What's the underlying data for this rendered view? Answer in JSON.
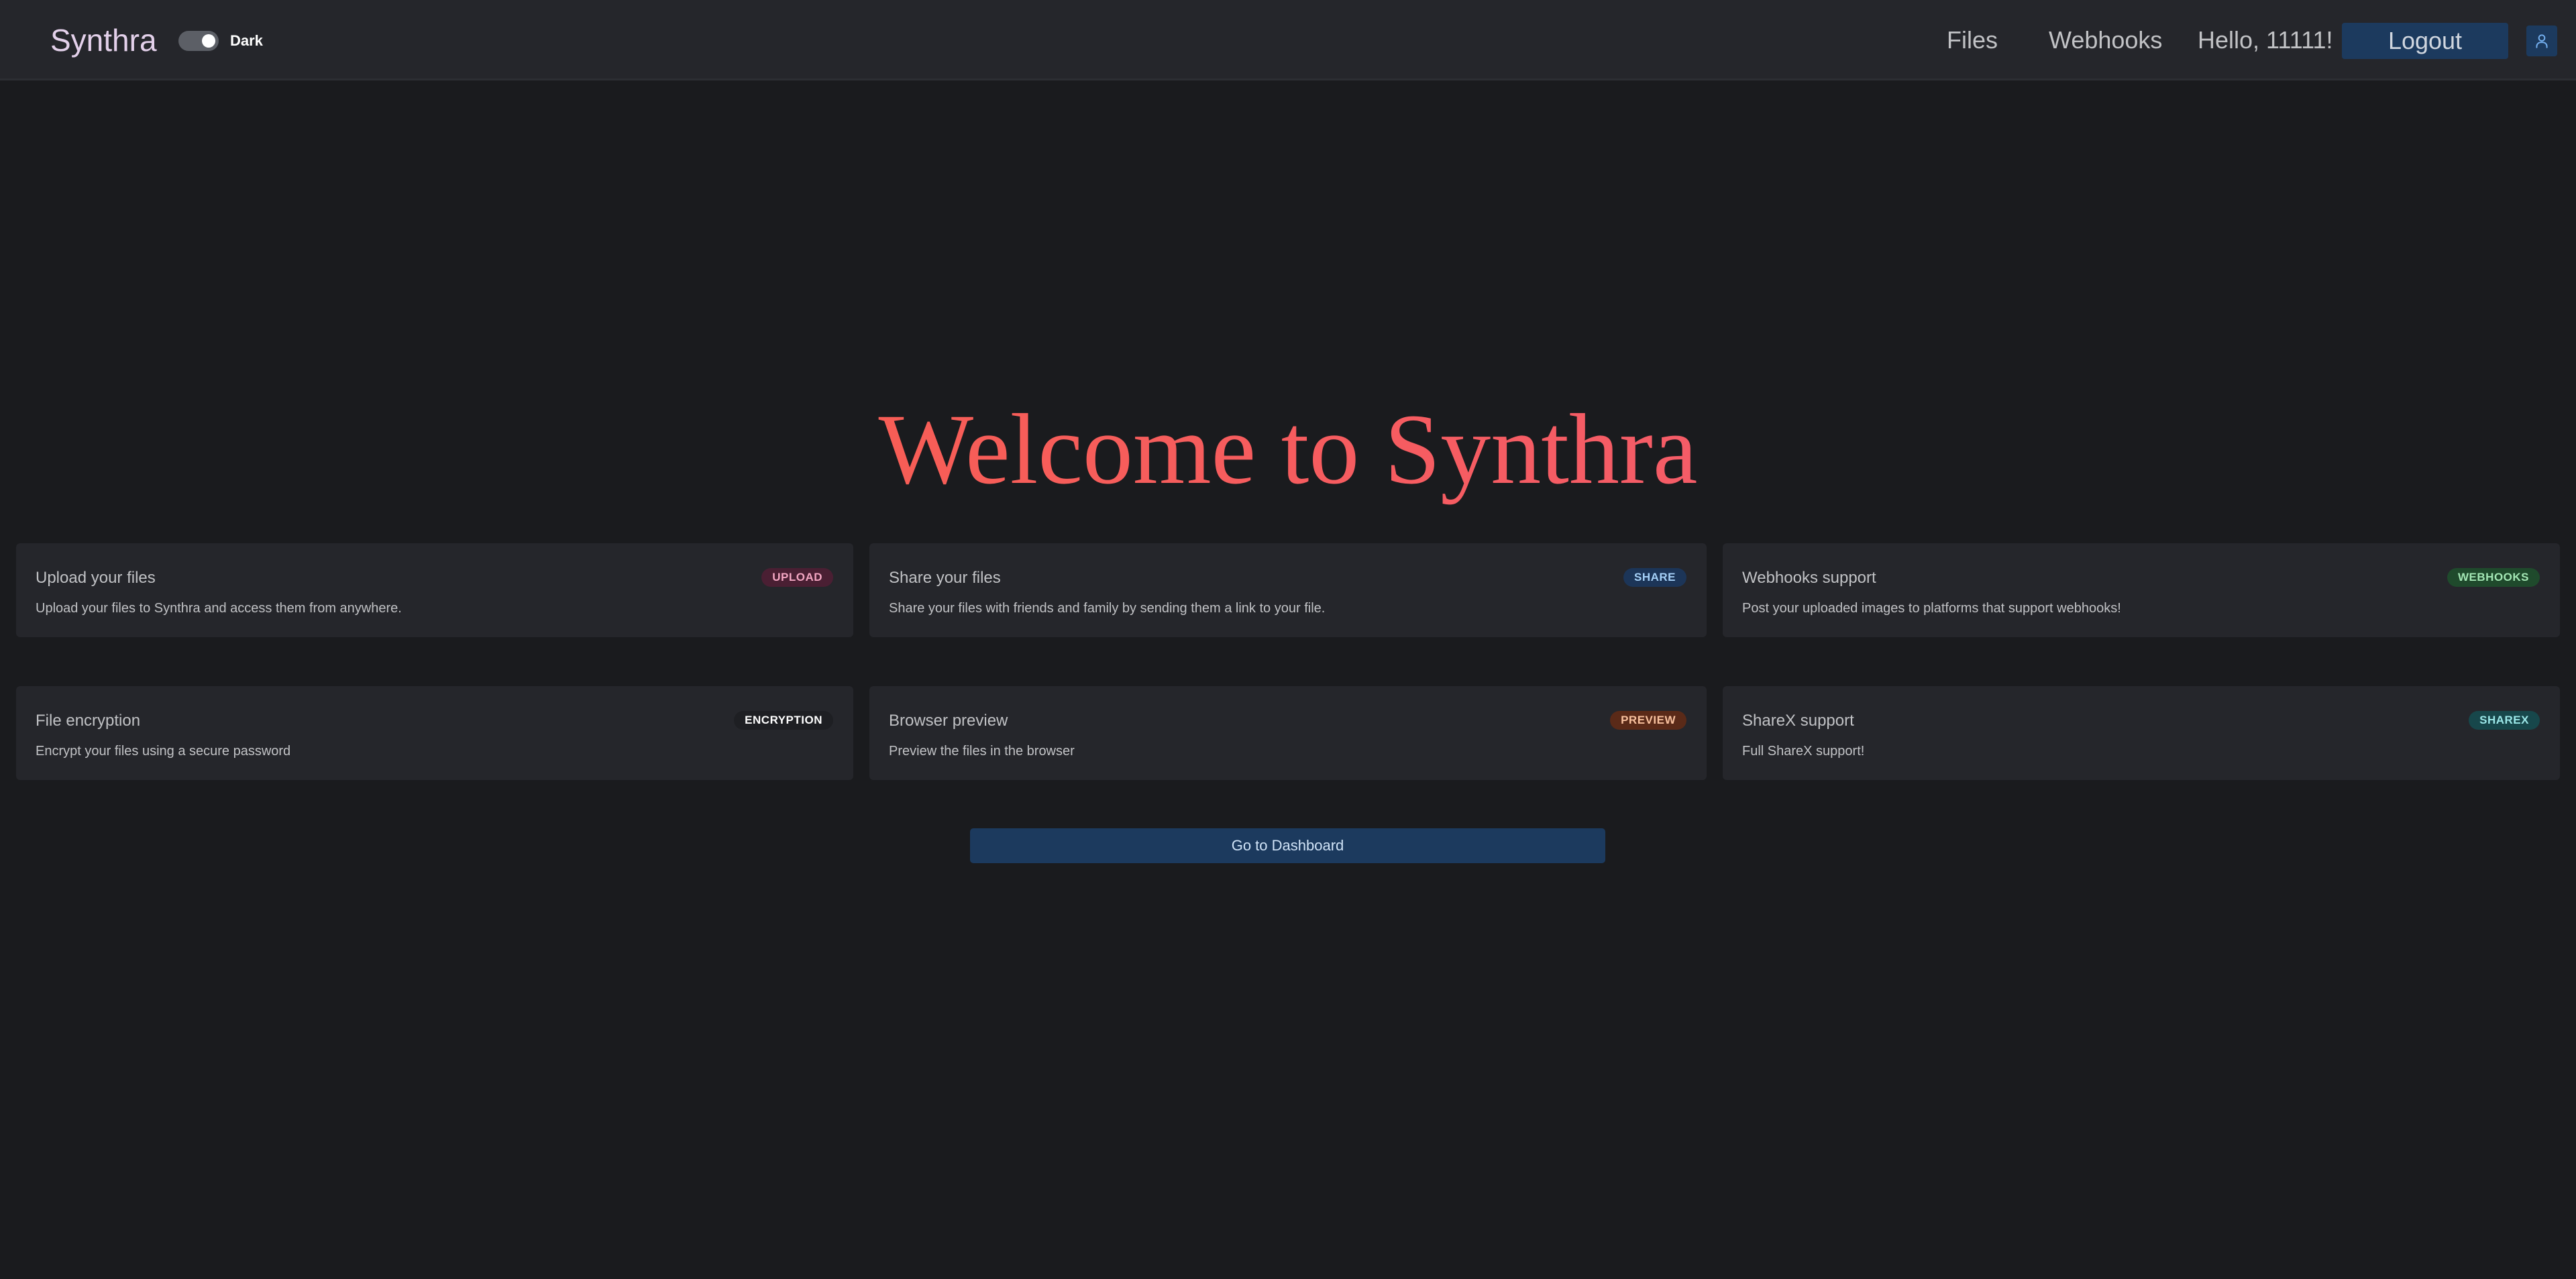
{
  "header": {
    "brand": "Synthra",
    "theme_toggle": {
      "label": "Dark",
      "on": true
    },
    "nav": [
      {
        "label": "Files"
      },
      {
        "label": "Webhooks"
      }
    ],
    "greeting": "Hello, 11111!",
    "logout_label": "Logout",
    "user_icon": "user-icon"
  },
  "hero": {
    "title": "Welcome to Synthra",
    "gradient": [
      "#fa5f43",
      "#f25a7a"
    ]
  },
  "features": [
    {
      "title": "Upload your files",
      "description": "Upload your files to Synthra and access them from anywhere.",
      "badge": "UPLOAD",
      "badge_bg": "#4a1f33",
      "badge_fg": "#f3a6c2"
    },
    {
      "title": "Share your files",
      "description": "Share your files with friends and family by sending them a link to your file.",
      "badge": "SHARE",
      "badge_bg": "#1c3558",
      "badge_fg": "#a5d0f7"
    },
    {
      "title": "Webhooks support",
      "description": "Post your uploaded images to platforms that support webhooks!",
      "badge": "WEBHOOKS",
      "badge_bg": "#1f4a2c",
      "badge_fg": "#a3e6b4"
    },
    {
      "title": "File encryption",
      "description": "Encrypt your files using a secure password",
      "badge": "ENCRYPTION",
      "badge_bg": "#1e1f23",
      "badge_fg": "#ffffff"
    },
    {
      "title": "Browser preview",
      "description": "Preview the files in the browser",
      "badge": "PREVIEW",
      "badge_bg": "#5a2a18",
      "badge_fg": "#f8c19e"
    },
    {
      "title": "ShareX support",
      "description": "Full ShareX support!",
      "badge": "SHAREX",
      "badge_bg": "#17474b",
      "badge_fg": "#9be7e8"
    }
  ],
  "dashboard_button": "Go to Dashboard"
}
